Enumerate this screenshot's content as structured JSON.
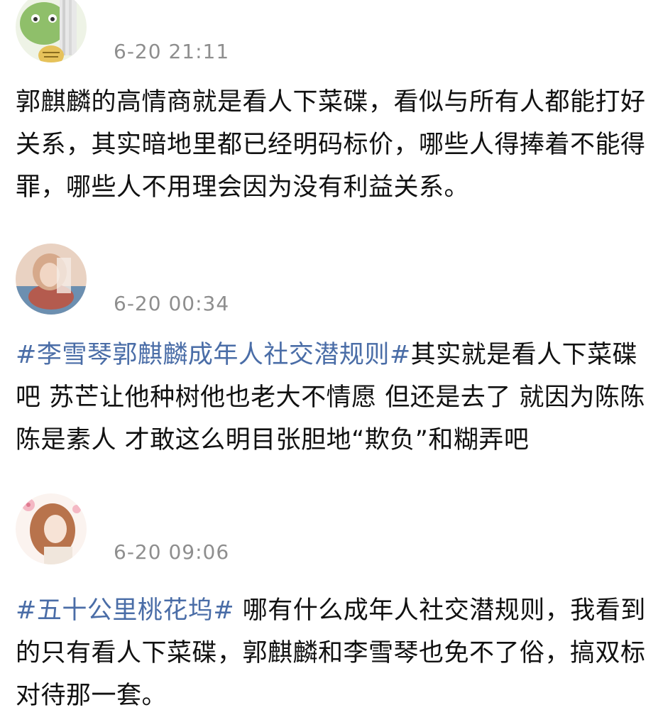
{
  "comments": [
    {
      "time": "6-20 21:11",
      "text": "郭麒麟的高情商就是看人下菜碟，看似与所有人都能打好关系，其实暗地里都已经明码标价，哪些人得捧着不能得罪，哪些人不用理会因为没有利益关系。",
      "avatar_icon": "frog-cartoon-avatar"
    },
    {
      "time": "6-20 00:34",
      "hashtag": "#李雪琴郭麒麟成年人社交潜规则#",
      "text": "其实就是看人下菜碟吧 苏芒让他种树他也老大不情愿 但还是去了 就因为陈陈陈是素人 才敢这么明目张胆地“欺负”和糊弄吧",
      "avatar_icon": "portrait-avatar"
    },
    {
      "time": "6-20 09:06",
      "hashtag": "#五十公里桃花坞#",
      "text": " 哪有什么成年人社交潜规则，我看到的只有看人下菜碟，郭麒麟和李雪琴也免不了俗，搞双标对待那一套。",
      "avatar_icon": "anime-girl-avatar"
    }
  ],
  "colors": {
    "hashtag": "#4a6da7",
    "timestamp": "#8e8e8e",
    "text": "#111111"
  }
}
